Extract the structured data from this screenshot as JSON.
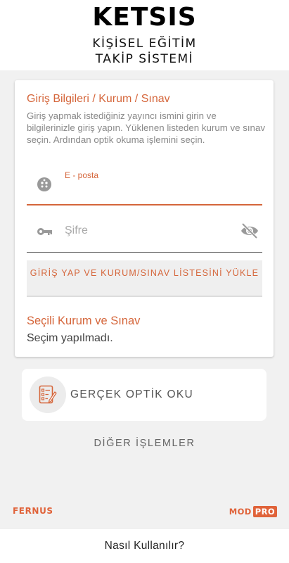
{
  "header": {
    "title": "KETSIS",
    "subtitle_line1": "KİŞİSEL EĞİTİM",
    "subtitle_line2": "TAKİP SİSTEMİ"
  },
  "login_card": {
    "title": "Giriş Bilgileri / Kurum / Sınav",
    "description": "Giriş yapmak istediğiniz yayıncı ismini girin ve bilgilerinizle giriş yapın. Yüklenen listeden kurum ve sınav seçin. Ardından optik okuma işlemini seçin.",
    "email_label": "E - posta",
    "email_icon": "face-icon",
    "password_placeholder": "Şifre",
    "password_icon": "key-icon",
    "visibility_icon": "eye-off-icon",
    "login_button_label": "GİRİŞ YAP VE KURUM/SINAV LİSTESİNİ YÜKLE",
    "selection_title": "Seçili Kurum ve Sınav",
    "selection_value": "Seçim yapılmadı."
  },
  "optik_button": {
    "label": "GERÇEK OPTİK OKU",
    "icon": "checklist-icon"
  },
  "other_actions_label": "DİĞER İŞLEMLER",
  "brands": {
    "left": "FERNUS",
    "right_mod": "MOD",
    "right_pro": "PRO"
  },
  "footer": {
    "help_label": "Nasıl Kullanılır?"
  },
  "colors": {
    "accent": "#d5663b",
    "background": "#f1f1f1"
  }
}
